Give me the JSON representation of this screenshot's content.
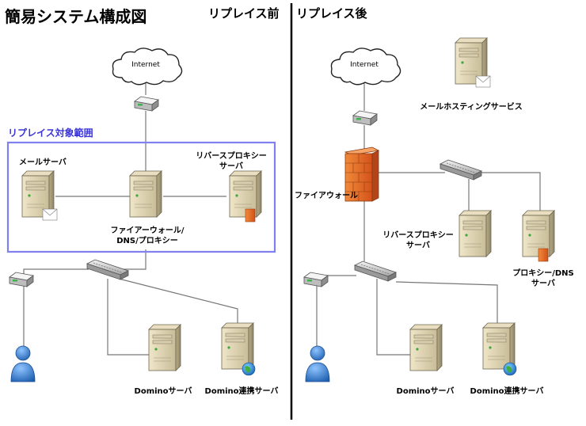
{
  "title": "簡易システム構成図",
  "before": {
    "heading": "リプレイス前",
    "scope_label": "リプレイス対象範囲",
    "internet": "Internet",
    "mail_server": "メールサーバ",
    "reverse_proxy_line1": "リバースプロキシー",
    "reverse_proxy_line2": "サーバ",
    "fw_line1": "ファイアーウォール/",
    "fw_line2": "DNS/プロキシー",
    "domino": "Dominoサーバ",
    "domino_link": "Domino連携サーバ"
  },
  "after": {
    "heading": "リプレイス後",
    "internet": "Internet",
    "mail_hosting": "メールホスティングサービス",
    "firewall": "ファイアウォール",
    "reverse_proxy_line1": "リバースプロキシー",
    "reverse_proxy_line2": "サーバ",
    "proxy_dns_line1": "プロキシー/DNS",
    "proxy_dns_line2": "サーバ",
    "domino": "Dominoサーバ",
    "domino_link": "Domino連携サーバ"
  }
}
